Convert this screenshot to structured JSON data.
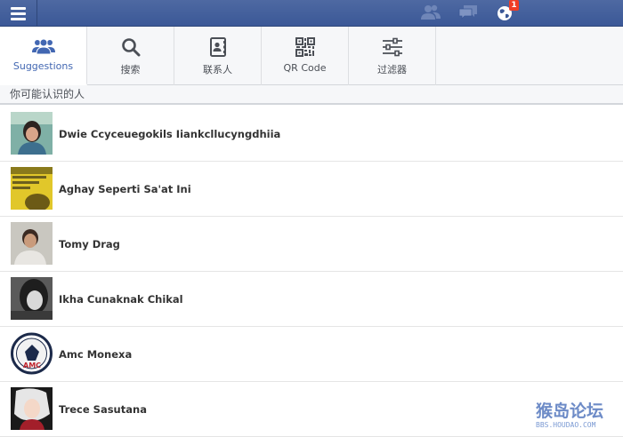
{
  "topbar": {
    "notification_count": "1",
    "colors": {
      "bar": "#3b5897",
      "icon_inactive": "#6f86b8",
      "badge": "#f03d25"
    }
  },
  "tabs": [
    {
      "label": "Suggestions",
      "icon": "people-icon",
      "active": true
    },
    {
      "label": "搜索",
      "icon": "search-icon",
      "active": false
    },
    {
      "label": "联系人",
      "icon": "contacts-icon",
      "active": false
    },
    {
      "label": "QR Code",
      "icon": "qr-code-icon",
      "active": false
    },
    {
      "label": "过滤器",
      "icon": "filter-sliders-icon",
      "active": false
    }
  ],
  "section": {
    "title": "你可能认识的人"
  },
  "people": [
    {
      "name": "Dwie Ccyceuegokils Iiankcllucyngdhiia"
    },
    {
      "name": "Aghay Seperti Sa'at Ini"
    },
    {
      "name": "Tomy Drag"
    },
    {
      "name": "Ikha Cunaknak Chikal"
    },
    {
      "name": "Amc Monexa"
    },
    {
      "name": "Trece Sasutana"
    }
  ],
  "watermark": {
    "title": "猴岛论坛",
    "url": "BBS.HOUDAO.COM"
  }
}
